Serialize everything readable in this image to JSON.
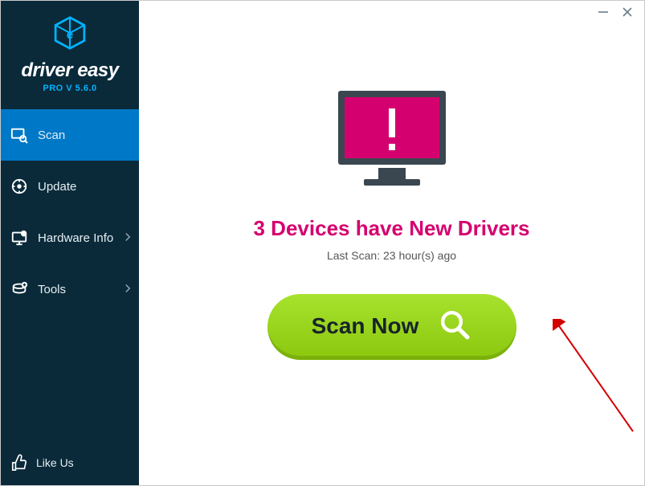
{
  "brand": {
    "name": "driver easy",
    "version": "PRO V 5.6.0"
  },
  "sidebar": {
    "items": [
      {
        "label": "Scan",
        "icon": "scan-icon",
        "expandable": false,
        "active": true
      },
      {
        "label": "Update",
        "icon": "update-icon",
        "expandable": false,
        "active": false
      },
      {
        "label": "Hardware Info",
        "icon": "hardware-icon",
        "expandable": true,
        "active": false
      },
      {
        "label": "Tools",
        "icon": "tools-icon",
        "expandable": true,
        "active": false
      }
    ],
    "like_label": "Like Us"
  },
  "main": {
    "headline": "3 Devices have New Drivers",
    "last_scan": "Last Scan: 23 hour(s) ago",
    "scan_button": "Scan Now"
  },
  "colors": {
    "accent_pink": "#d5006f",
    "accent_blue": "#0078c8",
    "scan_green": "#9bd41f"
  }
}
